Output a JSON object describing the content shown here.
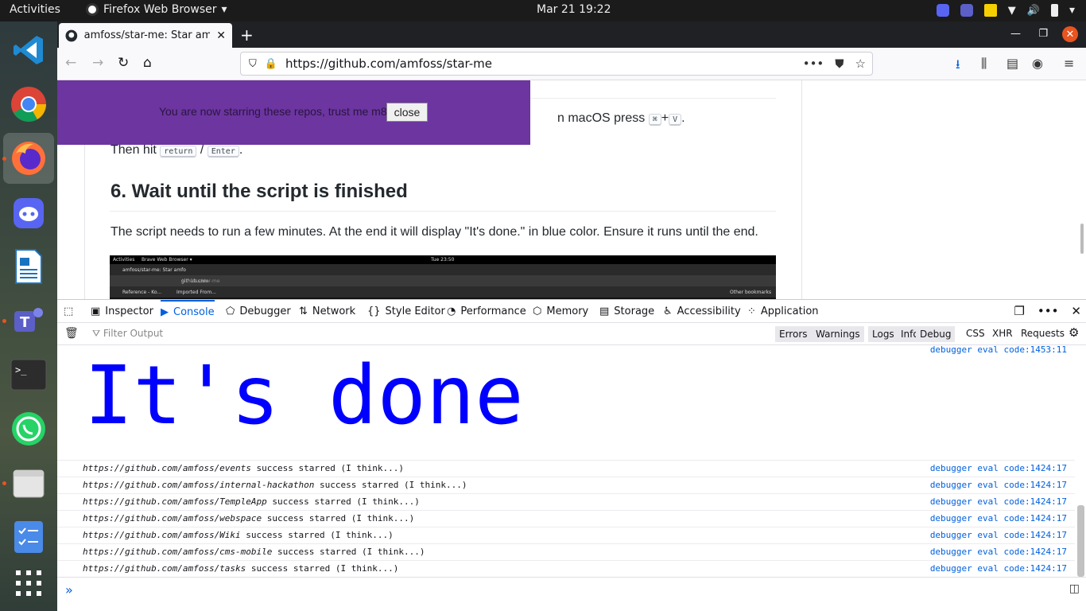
{
  "topbar": {
    "activities": "Activities",
    "app_name": "Firefox Web Browser",
    "clock": "Mar 21  19:22"
  },
  "dock": {
    "items": [
      "Visual Studio Code",
      "Google Chrome",
      "Firefox",
      "Discord",
      "LibreOffice Writer",
      "Microsoft Teams",
      "Terminal",
      "WhatsApp",
      "Files",
      "Tasks",
      "Show Applications"
    ]
  },
  "browser": {
    "tab_title": "amfoss/star-me: Star amfoss",
    "url": "https://github.com/amfoss/star-me",
    "url_actions": "•••"
  },
  "page": {
    "banner_text": "You are now starring these repos, trust me m8",
    "banner_close": "close",
    "paste_prefix": "n macOS press",
    "kbd_cmd": "⌘",
    "plus": "+",
    "kbd_v": "V",
    "period": ".",
    "then_hit": "Then hit",
    "kbd_return": "return",
    "slash": "/",
    "kbd_enter": "Enter",
    "heading": "6. Wait until the script is finished",
    "paragraph": "The script needs to run a few minutes. At the end it will display \"It's done.\" in blue color. Ensure it runs until the end.",
    "embed": {
      "activities": "Activities",
      "browser": "Brave Web Browser ▾",
      "clock": "Tue 23:50",
      "tab": "amfoss/star-me: Star amfo",
      "url_host": "github.com",
      "url_path": "/amfoss/star-me",
      "bm1": "Reference - Ko...",
      "bm2": "Imported From...",
      "bm3": "Other bookmarks"
    }
  },
  "devtools": {
    "tabs": [
      {
        "label": "Inspector",
        "icon": "inspector-icon"
      },
      {
        "label": "Console",
        "icon": "console-icon"
      },
      {
        "label": "Debugger",
        "icon": "debugger-icon"
      },
      {
        "label": "Network",
        "icon": "network-icon"
      },
      {
        "label": "Style Editor",
        "icon": "style-editor-icon"
      },
      {
        "label": "Performance",
        "icon": "performance-icon"
      },
      {
        "label": "Memory",
        "icon": "memory-icon"
      },
      {
        "label": "Storage",
        "icon": "storage-icon"
      },
      {
        "label": "Accessibility",
        "icon": "accessibility-icon"
      },
      {
        "label": "Application",
        "icon": "application-icon"
      }
    ],
    "selected_tab": "Console",
    "filter_placeholder": "Filter Output",
    "filters": [
      "Errors",
      "Warnings",
      "Logs",
      "Info",
      "Debug"
    ],
    "filters_plain": [
      "CSS",
      "XHR",
      "Requests"
    ],
    "big_message": "It's done",
    "big_location": "debugger eval code:1453:11",
    "logs": [
      {
        "url": "https://github.com/amfoss/events",
        "text": " success starred (I think...)",
        "location": "debugger eval code:1424:17"
      },
      {
        "url": "https://github.com/amfoss/internal-hackathon",
        "text": " success starred (I think...)",
        "location": "debugger eval code:1424:17"
      },
      {
        "url": "https://github.com/amfoss/TempleApp",
        "text": " success starred (I think...)",
        "location": "debugger eval code:1424:17"
      },
      {
        "url": "https://github.com/amfoss/webspace",
        "text": " success starred (I think...)",
        "location": "debugger eval code:1424:17"
      },
      {
        "url": "https://github.com/amfoss/Wiki",
        "text": " success starred (I think...)",
        "location": "debugger eval code:1424:17"
      },
      {
        "url": "https://github.com/amfoss/cms-mobile",
        "text": " success starred (I think...)",
        "location": "debugger eval code:1424:17"
      },
      {
        "url": "https://github.com/amfoss/tasks",
        "text": " success starred (I think...)",
        "location": "debugger eval code:1424:17"
      }
    ],
    "prompt": "»"
  },
  "colors": {
    "banner": "#6c35a0",
    "accent": "#0060df",
    "big_message": "#0000ff"
  }
}
